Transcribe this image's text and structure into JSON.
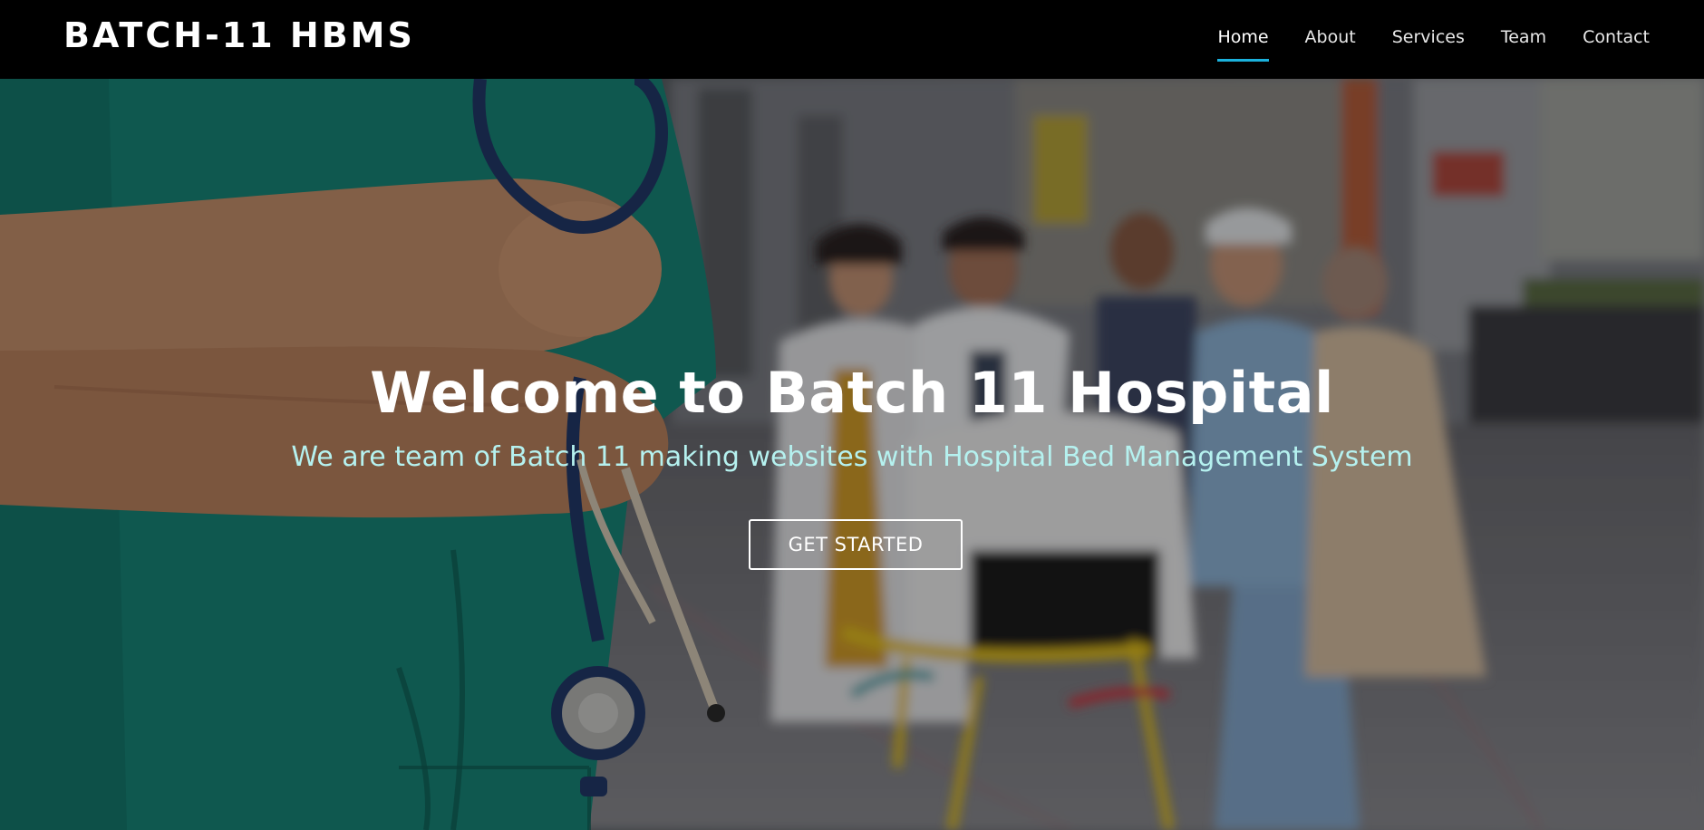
{
  "header": {
    "logo": "BATCH-11 HBMS",
    "nav": [
      {
        "label": "Home",
        "active": true
      },
      {
        "label": "About"
      },
      {
        "label": "Services"
      },
      {
        "label": "Team"
      },
      {
        "label": "Contact"
      }
    ]
  },
  "hero": {
    "title": "Welcome to Batch 11 Hospital",
    "subtitle": "We are team of Batch 11 making websites with Hospital Bed Management System",
    "cta_label": "GET STARTED",
    "background_image": "hospital-staff-with-stretcher-photo"
  },
  "colors": {
    "header_bg": "#000000",
    "nav_active_underline": "#1bb1dc",
    "subtitle": "#b5f1ef",
    "scrubs_green": "#17877a"
  }
}
